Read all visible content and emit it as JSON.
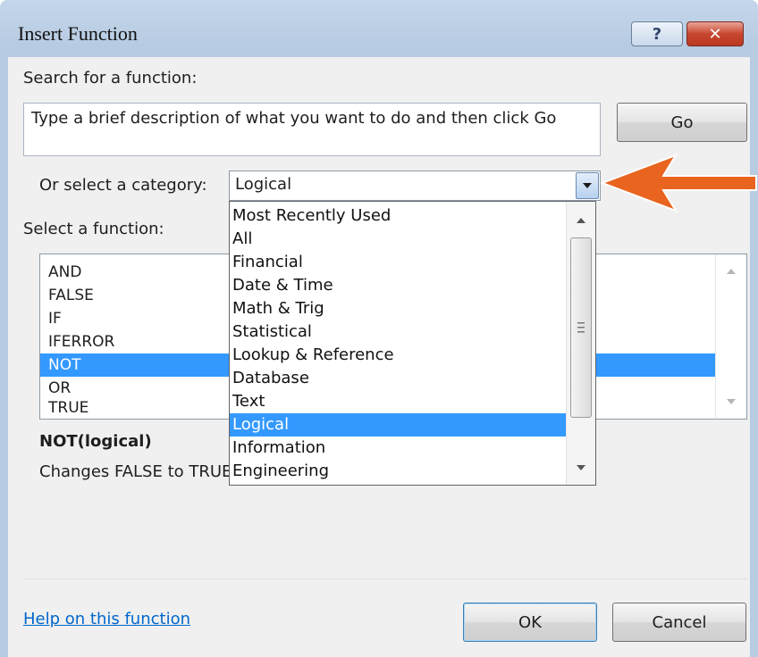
{
  "dialog": {
    "title": "Insert Function",
    "help_button": "?",
    "close_button": "✕"
  },
  "search": {
    "label": "Search for a function:",
    "text": "Type a brief description of what you want to do and then click Go",
    "go_button": "Go"
  },
  "category": {
    "label": "Or select a category:",
    "selected": "Logical",
    "options": [
      "Most Recently Used",
      "All",
      "Financial",
      "Date & Time",
      "Math & Trig",
      "Statistical",
      "Lookup & Reference",
      "Database",
      "Text",
      "Logical",
      "Information",
      "Engineering"
    ]
  },
  "functions": {
    "label": "Select a function:",
    "items": [
      "AND",
      "FALSE",
      "IF",
      "IFERROR",
      "NOT",
      "OR",
      "TRUE"
    ],
    "selected": "NOT"
  },
  "details": {
    "signature": "NOT(logical)",
    "description": "Changes FALSE to TRUE"
  },
  "footer": {
    "help_link": "Help on this function",
    "ok_button": "OK",
    "cancel_button": "Cancel"
  },
  "colors": {
    "selection": "#3399ff",
    "annotation_arrow": "#e8641f",
    "close_button": "#c8452e",
    "link": "#0066cc"
  }
}
